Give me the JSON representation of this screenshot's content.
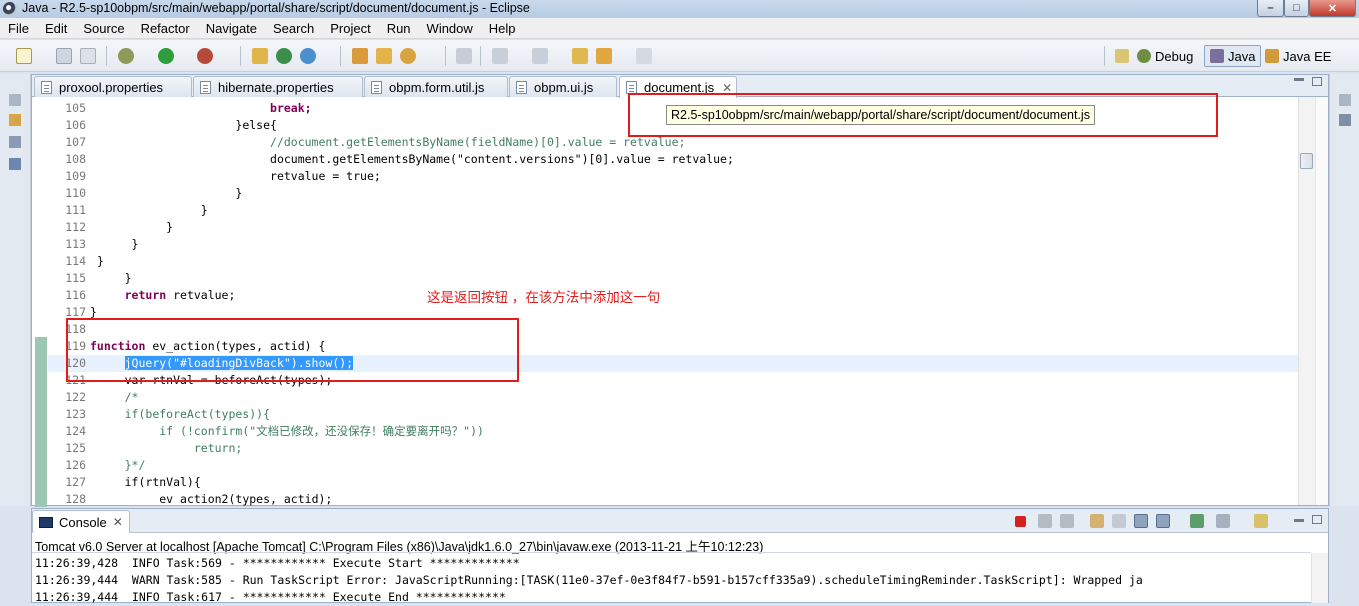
{
  "window": {
    "title": "Java - R2.5-sp10obpm/src/main/webapp/portal/share/script/document/document.js - Eclipse",
    "minimize_label": "–",
    "maximize_label": "□",
    "close_label": "✕"
  },
  "menu": [
    "File",
    "Edit",
    "Source",
    "Refactor",
    "Navigate",
    "Search",
    "Project",
    "Run",
    "Window",
    "Help"
  ],
  "perspectives": {
    "debug": "Debug",
    "java": "Java",
    "javaee": "Java EE"
  },
  "tabs": [
    {
      "label": "proxool.properties"
    },
    {
      "label": "hibernate.properties"
    },
    {
      "label": "obpm.form.util.js"
    },
    {
      "label": "obpm.ui.js"
    },
    {
      "label": "document.js",
      "close": "✕"
    }
  ],
  "tooltip": "R2.5-sp10obpm/src/main/webapp/portal/share/script/document/document.js",
  "annotation": "这是返回按钮 ，在该方法中添加这一句",
  "code_lines": [
    {
      "n": "105",
      "text": "break;"
    },
    {
      "n": "106",
      "text": "}else{"
    },
    {
      "n": "107",
      "text": "//document.getElementsByName(fieldName)[0].value = retvalue;"
    },
    {
      "n": "108",
      "text": "document.getElementsByName(\"content.versions\")[0].value = retvalue;"
    },
    {
      "n": "109",
      "text": "retvalue = true;"
    },
    {
      "n": "110",
      "text": "}"
    },
    {
      "n": "111",
      "text": "}"
    },
    {
      "n": "112",
      "text": "}"
    },
    {
      "n": "113",
      "text": "}"
    },
    {
      "n": "114",
      "text": "}"
    },
    {
      "n": "115",
      "text": "}"
    },
    {
      "n": "116",
      "text": "return retvalue;"
    },
    {
      "n": "117",
      "text": "}"
    },
    {
      "n": "118",
      "text": ""
    },
    {
      "n": "119",
      "text": "function ev_action(types, actid) {"
    },
    {
      "n": "120",
      "text": "jQuery(\"#loadingDivBack\").show();"
    },
    {
      "n": "121",
      "text": "var rtnVal = beforeAct(types);"
    },
    {
      "n": "122",
      "text": "/*"
    },
    {
      "n": "123",
      "text": "if(beforeAct(types)){"
    },
    {
      "n": "124",
      "text": "if (!confirm(\"文档已修改，还没保存！确定要离开吗？\"))"
    },
    {
      "n": "125",
      "text": "return;"
    },
    {
      "n": "126",
      "text": "}*/"
    },
    {
      "n": "127",
      "text": "if(rtnVal){"
    },
    {
      "n": "128",
      "text": "ev action2(types, actid);"
    }
  ],
  "console": {
    "tab_label": "Console",
    "close": "✕",
    "header": "Tomcat v6.0 Server at localhost [Apache Tomcat] C:\\Program Files (x86)\\Java\\jdk1.6.0_27\\bin\\javaw.exe (2013-11-21 上午10:12:23)",
    "lines": [
      "11:26:39,428  INFO Task:569 - ************ Execute Start *************",
      "11:26:39,444  WARN Task:585 - Run TaskScript Error: JavaScriptRunning:[TASK(11e0-37ef-0e3f84f7-b591-b157cff335a9).scheduleTimingReminder.TaskScript]: Wrapped ja",
      "11:26:39,444  INFO Task:617 - ************ Execute End *************"
    ]
  }
}
